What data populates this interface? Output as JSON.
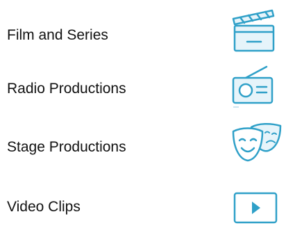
{
  "colors": {
    "icon": "#2fa0c8",
    "icon_fill": "#e6f4fa",
    "text": "#111111"
  },
  "items": [
    {
      "label": "Film and Series",
      "icon": "clapperboard-icon"
    },
    {
      "label": "Radio Productions",
      "icon": "radio-icon"
    },
    {
      "label": "Stage Productions",
      "icon": "theater-masks-icon"
    },
    {
      "label": "Video Clips",
      "icon": "play-video-icon"
    }
  ]
}
